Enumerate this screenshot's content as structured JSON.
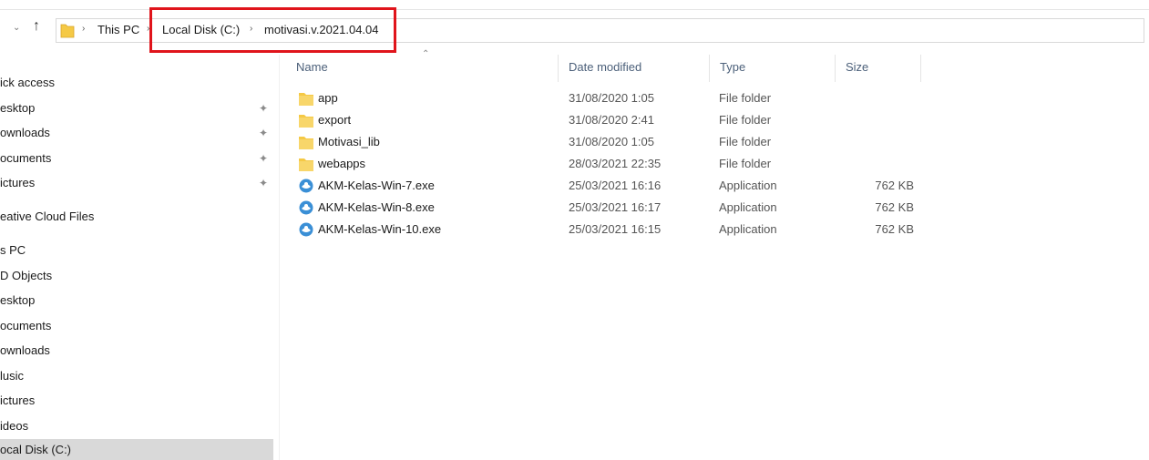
{
  "address": {
    "crumbs": [
      "This PC",
      "Local Disk (C:)",
      "motivasi.v.2021.04.04"
    ],
    "separators": [
      "›",
      "›",
      "›"
    ]
  },
  "nav": {
    "items": [
      {
        "label": "ick access",
        "pinned": false
      },
      {
        "label": "esktop",
        "pinned": true
      },
      {
        "label": "ownloads",
        "pinned": true
      },
      {
        "label": "ocuments",
        "pinned": true
      },
      {
        "label": "ictures",
        "pinned": true
      },
      {
        "label": "eative Cloud Files",
        "pinned": false
      },
      {
        "label": "s PC",
        "pinned": false
      },
      {
        "label": "D Objects",
        "pinned": false
      },
      {
        "label": "esktop",
        "pinned": false
      },
      {
        "label": "ocuments",
        "pinned": false
      },
      {
        "label": "ownloads",
        "pinned": false
      },
      {
        "label": "lusic",
        "pinned": false
      },
      {
        "label": "ictures",
        "pinned": false
      },
      {
        "label": "ideos",
        "pinned": false
      },
      {
        "label": "ocal Disk (C:)",
        "pinned": false,
        "selected": true
      }
    ]
  },
  "columns": {
    "name": "Name",
    "date": "Date modified",
    "type": "Type",
    "size": "Size"
  },
  "files": [
    {
      "name": "app",
      "date": "31/08/2020 1:05",
      "type": "File folder",
      "size": "",
      "icon": "folder-icon"
    },
    {
      "name": "export",
      "date": "31/08/2020 2:41",
      "type": "File folder",
      "size": "",
      "icon": "folder-icon"
    },
    {
      "name": "Motivasi_lib",
      "date": "31/08/2020 1:05",
      "type": "File folder",
      "size": "",
      "icon": "folder-icon"
    },
    {
      "name": "webapps",
      "date": "28/03/2021 22:35",
      "type": "File folder",
      "size": "",
      "icon": "folder-icon"
    },
    {
      "name": "AKM-Kelas-Win-7.exe",
      "date": "25/03/2021 16:16",
      "type": "Application",
      "size": "762 KB",
      "icon": "app-icon"
    },
    {
      "name": "AKM-Kelas-Win-8.exe",
      "date": "25/03/2021 16:17",
      "type": "Application",
      "size": "762 KB",
      "icon": "app-icon"
    },
    {
      "name": "AKM-Kelas-Win-10.exe",
      "date": "25/03/2021 16:15",
      "type": "Application",
      "size": "762 KB",
      "icon": "app-icon"
    }
  ],
  "colors": {
    "highlight": "#e0141b",
    "folder": "#f5c945",
    "app": "#3a8fd6",
    "selected_bg": "#d9d9d9"
  }
}
